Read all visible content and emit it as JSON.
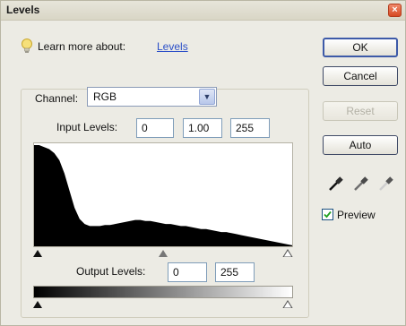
{
  "window": {
    "title": "Levels",
    "close_glyph": "×"
  },
  "learn": {
    "label": "Learn more about:",
    "link": "Levels"
  },
  "buttons": {
    "ok": "OK",
    "cancel": "Cancel",
    "reset": "Reset",
    "auto": "Auto"
  },
  "channel": {
    "label": "Channel:",
    "value": "RGB"
  },
  "input_levels": {
    "label": "Input Levels:",
    "black": "0",
    "gamma": "1.00",
    "white": "255"
  },
  "output_levels": {
    "label": "Output Levels:",
    "black": "0",
    "white": "255"
  },
  "preview": {
    "label": "Preview",
    "checked": true
  },
  "histogram": {
    "heights": [
      1.0,
      1.0,
      0.98,
      0.96,
      0.92,
      0.85,
      0.72,
      0.55,
      0.38,
      0.27,
      0.22,
      0.2,
      0.2,
      0.2,
      0.21,
      0.21,
      0.22,
      0.23,
      0.24,
      0.25,
      0.26,
      0.26,
      0.25,
      0.25,
      0.24,
      0.23,
      0.22,
      0.22,
      0.21,
      0.2,
      0.2,
      0.19,
      0.18,
      0.17,
      0.17,
      0.16,
      0.15,
      0.14,
      0.14,
      0.13,
      0.12,
      0.11,
      0.1,
      0.09,
      0.08,
      0.07,
      0.06,
      0.05,
      0.04,
      0.03,
      0.02,
      0.01
    ]
  },
  "colors": {
    "histogram_fill": "#000000",
    "link": "#2b4fc8",
    "dialog_bg": "#ecebe4"
  },
  "icons": [
    "bulb-icon",
    "close-icon",
    "chevron-down-icon",
    "black-eyedropper-icon",
    "gray-eyedropper-icon",
    "white-eyedropper-icon",
    "checkmark-icon"
  ]
}
